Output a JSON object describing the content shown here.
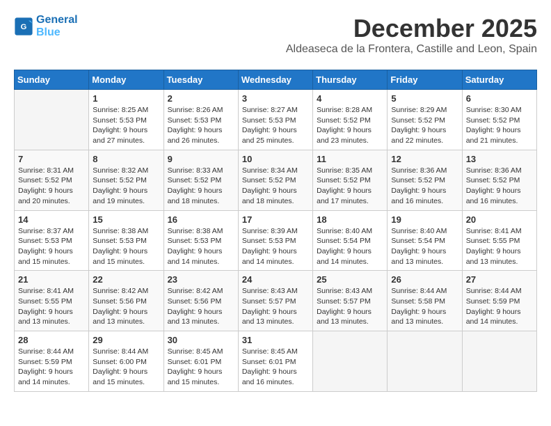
{
  "header": {
    "logo_line1": "General",
    "logo_line2": "Blue",
    "month_title": "December 2025",
    "location": "Aldeaseca de la Frontera, Castille and Leon, Spain"
  },
  "weekdays": [
    "Sunday",
    "Monday",
    "Tuesday",
    "Wednesday",
    "Thursday",
    "Friday",
    "Saturday"
  ],
  "weeks": [
    [
      {
        "day": "",
        "sunrise": "",
        "sunset": "",
        "daylight": ""
      },
      {
        "day": "1",
        "sunrise": "Sunrise: 8:25 AM",
        "sunset": "Sunset: 5:53 PM",
        "daylight": "Daylight: 9 hours and 27 minutes."
      },
      {
        "day": "2",
        "sunrise": "Sunrise: 8:26 AM",
        "sunset": "Sunset: 5:53 PM",
        "daylight": "Daylight: 9 hours and 26 minutes."
      },
      {
        "day": "3",
        "sunrise": "Sunrise: 8:27 AM",
        "sunset": "Sunset: 5:53 PM",
        "daylight": "Daylight: 9 hours and 25 minutes."
      },
      {
        "day": "4",
        "sunrise": "Sunrise: 8:28 AM",
        "sunset": "Sunset: 5:52 PM",
        "daylight": "Daylight: 9 hours and 23 minutes."
      },
      {
        "day": "5",
        "sunrise": "Sunrise: 8:29 AM",
        "sunset": "Sunset: 5:52 PM",
        "daylight": "Daylight: 9 hours and 22 minutes."
      },
      {
        "day": "6",
        "sunrise": "Sunrise: 8:30 AM",
        "sunset": "Sunset: 5:52 PM",
        "daylight": "Daylight: 9 hours and 21 minutes."
      }
    ],
    [
      {
        "day": "7",
        "sunrise": "Sunrise: 8:31 AM",
        "sunset": "Sunset: 5:52 PM",
        "daylight": "Daylight: 9 hours and 20 minutes."
      },
      {
        "day": "8",
        "sunrise": "Sunrise: 8:32 AM",
        "sunset": "Sunset: 5:52 PM",
        "daylight": "Daylight: 9 hours and 19 minutes."
      },
      {
        "day": "9",
        "sunrise": "Sunrise: 8:33 AM",
        "sunset": "Sunset: 5:52 PM",
        "daylight": "Daylight: 9 hours and 18 minutes."
      },
      {
        "day": "10",
        "sunrise": "Sunrise: 8:34 AM",
        "sunset": "Sunset: 5:52 PM",
        "daylight": "Daylight: 9 hours and 18 minutes."
      },
      {
        "day": "11",
        "sunrise": "Sunrise: 8:35 AM",
        "sunset": "Sunset: 5:52 PM",
        "daylight": "Daylight: 9 hours and 17 minutes."
      },
      {
        "day": "12",
        "sunrise": "Sunrise: 8:36 AM",
        "sunset": "Sunset: 5:52 PM",
        "daylight": "Daylight: 9 hours and 16 minutes."
      },
      {
        "day": "13",
        "sunrise": "Sunrise: 8:36 AM",
        "sunset": "Sunset: 5:52 PM",
        "daylight": "Daylight: 9 hours and 16 minutes."
      }
    ],
    [
      {
        "day": "14",
        "sunrise": "Sunrise: 8:37 AM",
        "sunset": "Sunset: 5:53 PM",
        "daylight": "Daylight: 9 hours and 15 minutes."
      },
      {
        "day": "15",
        "sunrise": "Sunrise: 8:38 AM",
        "sunset": "Sunset: 5:53 PM",
        "daylight": "Daylight: 9 hours and 15 minutes."
      },
      {
        "day": "16",
        "sunrise": "Sunrise: 8:38 AM",
        "sunset": "Sunset: 5:53 PM",
        "daylight": "Daylight: 9 hours and 14 minutes."
      },
      {
        "day": "17",
        "sunrise": "Sunrise: 8:39 AM",
        "sunset": "Sunset: 5:53 PM",
        "daylight": "Daylight: 9 hours and 14 minutes."
      },
      {
        "day": "18",
        "sunrise": "Sunrise: 8:40 AM",
        "sunset": "Sunset: 5:54 PM",
        "daylight": "Daylight: 9 hours and 14 minutes."
      },
      {
        "day": "19",
        "sunrise": "Sunrise: 8:40 AM",
        "sunset": "Sunset: 5:54 PM",
        "daylight": "Daylight: 9 hours and 13 minutes."
      },
      {
        "day": "20",
        "sunrise": "Sunrise: 8:41 AM",
        "sunset": "Sunset: 5:55 PM",
        "daylight": "Daylight: 9 hours and 13 minutes."
      }
    ],
    [
      {
        "day": "21",
        "sunrise": "Sunrise: 8:41 AM",
        "sunset": "Sunset: 5:55 PM",
        "daylight": "Daylight: 9 hours and 13 minutes."
      },
      {
        "day": "22",
        "sunrise": "Sunrise: 8:42 AM",
        "sunset": "Sunset: 5:56 PM",
        "daylight": "Daylight: 9 hours and 13 minutes."
      },
      {
        "day": "23",
        "sunrise": "Sunrise: 8:42 AM",
        "sunset": "Sunset: 5:56 PM",
        "daylight": "Daylight: 9 hours and 13 minutes."
      },
      {
        "day": "24",
        "sunrise": "Sunrise: 8:43 AM",
        "sunset": "Sunset: 5:57 PM",
        "daylight": "Daylight: 9 hours and 13 minutes."
      },
      {
        "day": "25",
        "sunrise": "Sunrise: 8:43 AM",
        "sunset": "Sunset: 5:57 PM",
        "daylight": "Daylight: 9 hours and 13 minutes."
      },
      {
        "day": "26",
        "sunrise": "Sunrise: 8:44 AM",
        "sunset": "Sunset: 5:58 PM",
        "daylight": "Daylight: 9 hours and 13 minutes."
      },
      {
        "day": "27",
        "sunrise": "Sunrise: 8:44 AM",
        "sunset": "Sunset: 5:59 PM",
        "daylight": "Daylight: 9 hours and 14 minutes."
      }
    ],
    [
      {
        "day": "28",
        "sunrise": "Sunrise: 8:44 AM",
        "sunset": "Sunset: 5:59 PM",
        "daylight": "Daylight: 9 hours and 14 minutes."
      },
      {
        "day": "29",
        "sunrise": "Sunrise: 8:44 AM",
        "sunset": "Sunset: 6:00 PM",
        "daylight": "Daylight: 9 hours and 15 minutes."
      },
      {
        "day": "30",
        "sunrise": "Sunrise: 8:45 AM",
        "sunset": "Sunset: 6:01 PM",
        "daylight": "Daylight: 9 hours and 15 minutes."
      },
      {
        "day": "31",
        "sunrise": "Sunrise: 8:45 AM",
        "sunset": "Sunset: 6:01 PM",
        "daylight": "Daylight: 9 hours and 16 minutes."
      },
      {
        "day": "",
        "sunrise": "",
        "sunset": "",
        "daylight": ""
      },
      {
        "day": "",
        "sunrise": "",
        "sunset": "",
        "daylight": ""
      },
      {
        "day": "",
        "sunrise": "",
        "sunset": "",
        "daylight": ""
      }
    ]
  ]
}
